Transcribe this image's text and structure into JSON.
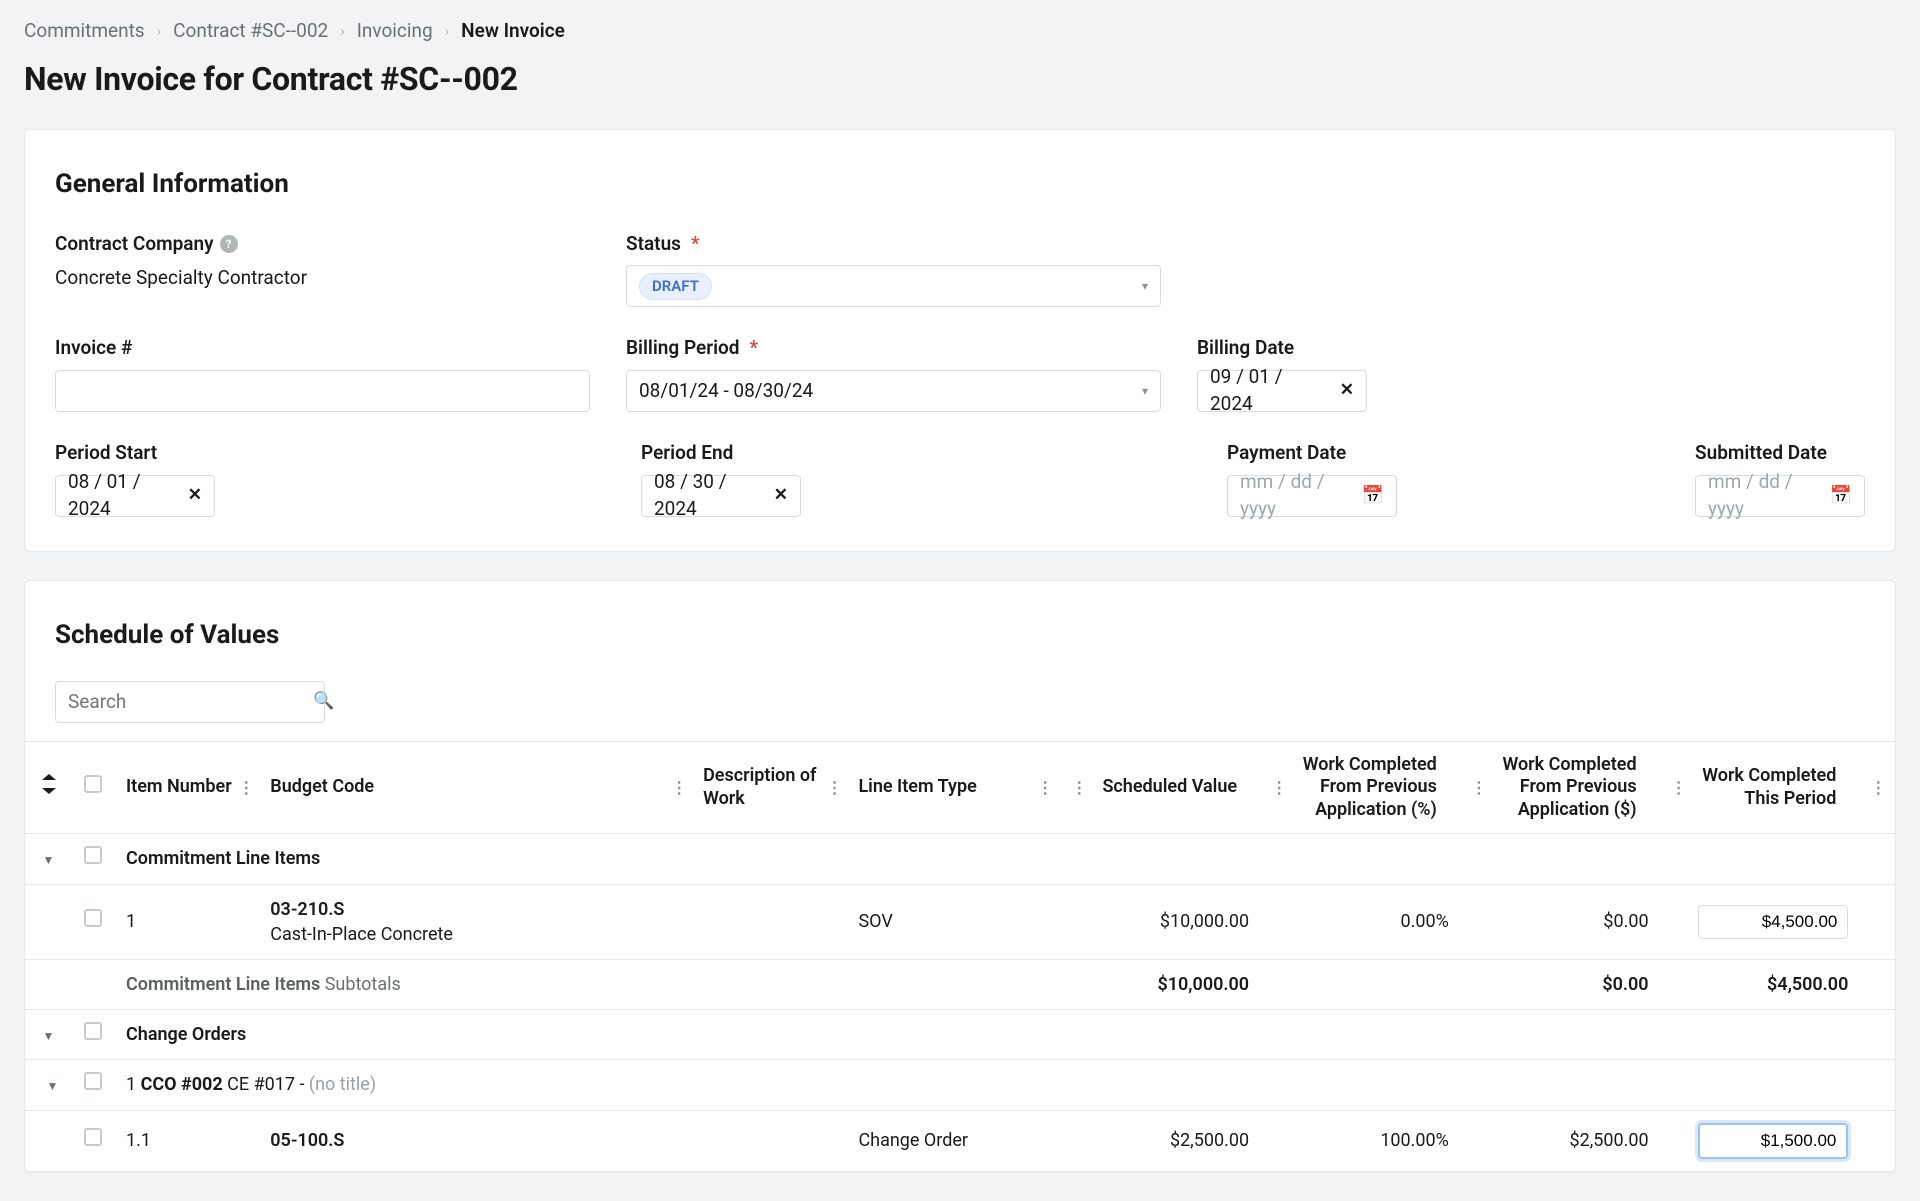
{
  "breadcrumb": {
    "items": [
      {
        "label": "Commitments"
      },
      {
        "label": "Contract #SC--002"
      },
      {
        "label": "Invoicing"
      }
    ],
    "current": "New Invoice"
  },
  "page_title": "New Invoice for Contract #SC--002",
  "general": {
    "heading": "General Information",
    "contract_company": {
      "label": "Contract Company",
      "value": "Concrete Specialty Contractor"
    },
    "status": {
      "label": "Status",
      "value": "DRAFT"
    },
    "invoice_number": {
      "label": "Invoice #",
      "value": ""
    },
    "billing_period": {
      "label": "Billing Period",
      "value": "08/01/24 - 08/30/24"
    },
    "billing_date": {
      "label": "Billing Date",
      "value": "09 / 01 / 2024"
    },
    "period_start": {
      "label": "Period Start",
      "value": "08 / 01 / 2024"
    },
    "period_end": {
      "label": "Period End",
      "value": "08 / 30 / 2024"
    },
    "payment_date": {
      "label": "Payment Date",
      "placeholder": "mm / dd / yyyy"
    },
    "submitted_date": {
      "label": "Submitted Date",
      "placeholder": "mm / dd / yyyy"
    }
  },
  "sov": {
    "heading": "Schedule of Values",
    "search_placeholder": "Search",
    "columns": {
      "item_number": "Item Number",
      "budget_code": "Budget Code",
      "desc": "Description of Work",
      "type": "Line Item Type",
      "sched": "Scheduled Value",
      "wcp_pct": "Work Completed From Previous Application (%)",
      "wcp_amt": "Work Completed From Previous Application ($)",
      "wct": "Work Completed This Period"
    },
    "groups": {
      "commitment": {
        "title": "Commitment Line Items",
        "subtotal_label_strong": "Commitment Line Items",
        "subtotal_label_light": "Subtotals",
        "rows": [
          {
            "item": "1",
            "code": "03-210.S",
            "desc": "Cast-In-Place Concrete",
            "type": "SOV",
            "sched": "$10,000.00",
            "wcp_pct": "0.00%",
            "wcp_amt": "$0.00",
            "wct": "$4,500.00"
          }
        ],
        "subtotals": {
          "sched": "$10,000.00",
          "wcp_amt": "$0.00",
          "wct": "$4,500.00"
        }
      },
      "change_orders": {
        "title": "Change Orders",
        "sub": {
          "prefix": "1",
          "label_strong": "CCO #002",
          "label_rest": "CE #017 -",
          "notitle": "(no title)"
        },
        "rows": [
          {
            "item": "1.1",
            "code": "05-100.S",
            "type": "Change Order",
            "sched": "$2,500.00",
            "wcp_pct": "100.00%",
            "wcp_amt": "$2,500.00",
            "wct": "$1,500.00"
          }
        ]
      }
    }
  }
}
